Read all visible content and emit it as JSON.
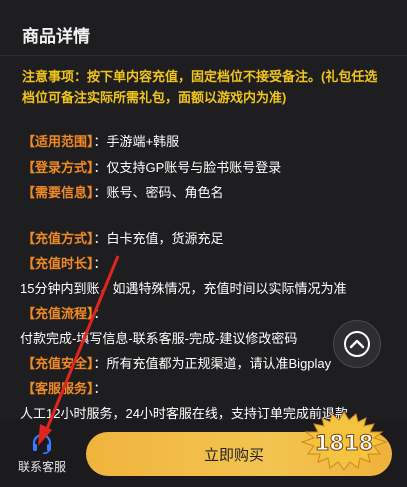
{
  "section": {
    "title": "商品详情"
  },
  "notice": "注意事项：按下单内容充值，固定档位不接受备注。(礼包任选档位可备注实际所需礼包，面额以游戏内为准)",
  "details": [
    {
      "label": "【适用范围】",
      "value": "：手游端+韩服"
    },
    {
      "label": "【登录方式】",
      "value": "：仅支持GP账号与脸书账号登录"
    },
    {
      "label": "【需要信息】",
      "value": "：账号、密码、角色名"
    },
    {
      "label": "【充值方式】",
      "value": "：白卡充值，货源充足"
    },
    {
      "label": "【充值时长】",
      "value": "："
    },
    {
      "text": "15分钟内到账，如遇特殊情况，充值时间以实际情况为准"
    },
    {
      "label": "【充值流程】",
      "value": "："
    },
    {
      "text": "付款完成-填写信息-联系客服-完成-建议修改密码"
    },
    {
      "label": "【充值安全】",
      "value": "：所有充值都为正规渠道，请认准Bigplay"
    },
    {
      "label": "【客服服务】",
      "value": "："
    },
    {
      "text": "人工12小时服务，24小时客服在线，支持订单完成前退款"
    }
  ],
  "bottom": {
    "customer_service": "联系客服",
    "buy_now": "立即购买"
  },
  "watermark": "1818",
  "icons": {
    "headset": "headset-icon",
    "scroll_up": "chevron-up-icon",
    "arrow": "red-arrow-annotation"
  },
  "colors": {
    "background": "#1e1e21",
    "label": "#f08a24",
    "notice": "#f0c419",
    "button": "#f3c451",
    "headset": "#3a7bff",
    "arrow": "#e0261c"
  }
}
